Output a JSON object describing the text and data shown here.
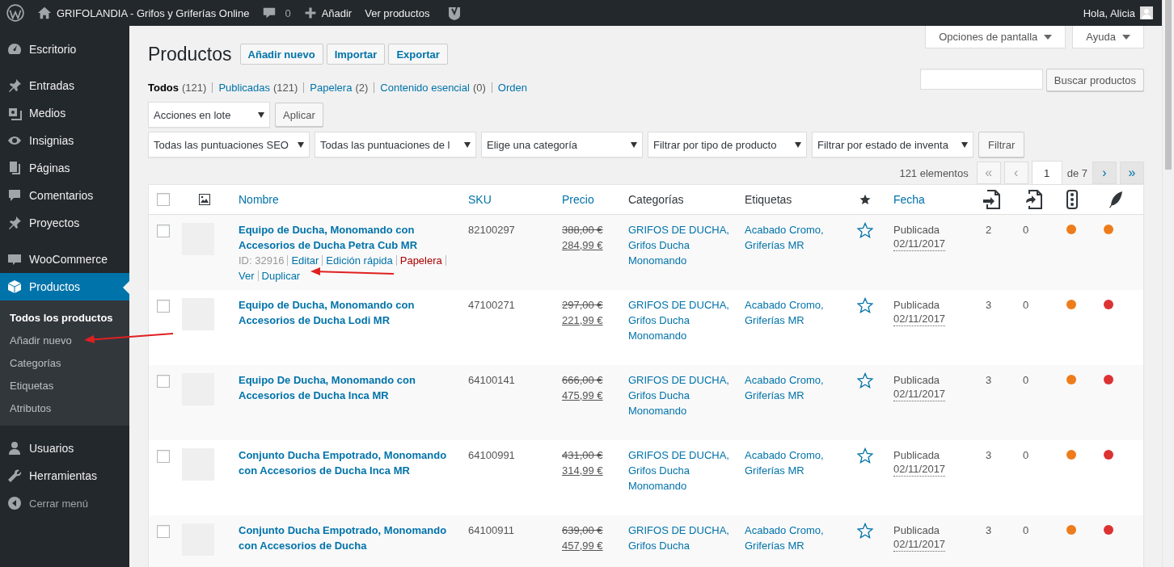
{
  "admin_bar": {
    "site_name": "GRIFOLANDIA - Grifos y Griferías Online",
    "comments_count": "0",
    "new_label": "Añadir",
    "view_label": "Ver productos",
    "greeting": "Hola, Alicia"
  },
  "sidebar": {
    "groups": [
      [
        {
          "label": "Escritorio",
          "kind": "menu",
          "selected": false
        }
      ],
      [
        {
          "label": "Entradas",
          "kind": "menu",
          "selected": false
        },
        {
          "label": "Medios",
          "kind": "menu",
          "selected": false
        },
        {
          "label": "Insignias",
          "kind": "menu",
          "selected": false
        },
        {
          "label": "Páginas",
          "kind": "menu",
          "selected": false
        },
        {
          "label": "Comentarios",
          "kind": "menu",
          "selected": false
        },
        {
          "label": "Proyectos",
          "kind": "menu",
          "selected": false
        }
      ],
      [
        {
          "label": "WooCommerce",
          "kind": "menu",
          "selected": false
        },
        {
          "label": "Productos",
          "kind": "menu",
          "selected": true,
          "children": [
            {
              "label": "Todos los productos",
              "selected": true
            },
            {
              "label": "Añadir nuevo",
              "selected": false
            },
            {
              "label": "Categorías",
              "selected": false
            },
            {
              "label": "Etiquetas",
              "selected": false
            },
            {
              "label": "Atributos",
              "selected": false
            }
          ]
        }
      ],
      [
        {
          "label": "Usuarios",
          "kind": "menu",
          "selected": false
        },
        {
          "label": "Herramientas",
          "kind": "menu",
          "selected": false
        },
        {
          "label": "Cerrar menú",
          "kind": "collapse",
          "selected": false
        }
      ]
    ]
  },
  "screen_tabs": [
    "Opciones de pantalla",
    "Ayuda"
  ],
  "page_title": "Productos",
  "title_actions": [
    "Añadir nuevo",
    "Importar",
    "Exportar"
  ],
  "status_links": [
    {
      "label": "Todos",
      "count": "(121)",
      "selected": true
    },
    {
      "label": "Publicadas",
      "count": "(121)",
      "selected": false
    },
    {
      "label": "Papelera",
      "count": "(2)",
      "selected": false
    },
    {
      "label": "Contenido esencial",
      "count": "(0)",
      "selected": false
    },
    {
      "label": "Orden",
      "selected": false
    }
  ],
  "search": {
    "button": "Buscar productos"
  },
  "bulk_actions": {
    "select": "Acciones en lote",
    "button": "Aplicar"
  },
  "filters": {
    "selects": [
      "Todas las puntuaciones SEO",
      "Todas las puntuaciones de l",
      "Elige una categoría",
      "Filtrar por tipo de producto",
      "Filtrar por estado de inventa"
    ],
    "button": "Filtrar"
  },
  "pagination": {
    "count": "121 elementos",
    "first": {
      "label": "«",
      "disabled": true
    },
    "prev": {
      "label": "‹",
      "disabled": true
    },
    "current": "1",
    "total": "de 7",
    "next": {
      "label": "›",
      "disabled": false
    },
    "last": {
      "label": "»",
      "disabled": false
    }
  },
  "table": {
    "select_all_checked": false,
    "columns": [
      {
        "label": "Nombre",
        "sortable": true
      },
      {
        "label": "SKU",
        "sortable": true
      },
      {
        "label": "Precio",
        "sortable": true
      },
      {
        "label": "Categorías",
        "sortable": false
      },
      {
        "label": "Etiquetas",
        "sortable": false
      },
      {
        "label": "Fecha",
        "sortable": true
      }
    ],
    "rows": [
      {
        "checked": false,
        "name": "Equipo de Ducha, Monomando con Accesorios de Ducha Petra Cub MR",
        "actions": [
          {
            "label": "ID: 32916",
            "kind": "id"
          },
          {
            "label": "Editar",
            "kind": "link"
          },
          {
            "label": "Edición rápida",
            "kind": "link"
          },
          {
            "label": "Papelera",
            "kind": "delete"
          },
          {
            "label": "Ver",
            "kind": "link"
          },
          {
            "label": "Duplicar",
            "kind": "link"
          }
        ],
        "sku": "82100297",
        "regular_price": "388,00 €",
        "sale_price": "284,99 €",
        "categories": "GRIFOS DE DUCHA, Grifos Ducha Monomando",
        "tags": "Acabado Cromo, Griferías MR",
        "featured": false,
        "status": "Publicada",
        "date": "02/11/2017",
        "links_in": "2",
        "links_out": "0",
        "status_dots": [
          {
            "color": "#ee7c1b"
          },
          {
            "color": "#ee7c1b"
          }
        ]
      },
      {
        "checked": false,
        "name": "Equipo de Ducha, Monomando con Accesorios de Ducha Lodi MR",
        "sku": "47100271",
        "regular_price": "297,00 €",
        "sale_price": "221,99 €",
        "categories": "GRIFOS DE DUCHA, Grifos Ducha Monomando",
        "tags": "Acabado Cromo, Griferías MR",
        "featured": false,
        "status": "Publicada",
        "date": "02/11/2017",
        "links_in": "3",
        "links_out": "0",
        "status_dots": [
          {
            "color": "#ee7c1b"
          },
          {
            "color": "#dc3232"
          }
        ]
      },
      {
        "checked": false,
        "name": "Equipo De Ducha, Monomando con Accesorios de Ducha Inca MR",
        "sku": "64100141",
        "regular_price": "666,00 €",
        "sale_price": "475,99 €",
        "categories": "GRIFOS DE DUCHA, Grifos Ducha Monomando",
        "tags": "Acabado Cromo, Griferías MR",
        "featured": false,
        "status": "Publicada",
        "date": "02/11/2017",
        "links_in": "3",
        "links_out": "0",
        "status_dots": [
          {
            "color": "#ee7c1b"
          },
          {
            "color": "#dc3232"
          }
        ]
      },
      {
        "checked": false,
        "name": "Conjunto Ducha Empotrado, Monomando con Accesorios de Ducha Inca MR",
        "sku": "64100991",
        "regular_price": "431,00 €",
        "sale_price": "314,99 €",
        "categories": "GRIFOS DE DUCHA, Grifos Ducha Monomando",
        "tags": "Acabado Cromo, Griferías MR",
        "featured": false,
        "status": "Publicada",
        "date": "02/11/2017",
        "links_in": "3",
        "links_out": "0",
        "status_dots": [
          {
            "color": "#ee7c1b"
          },
          {
            "color": "#dc3232"
          }
        ]
      },
      {
        "checked": false,
        "name": "Conjunto Ducha Empotrado, Monomando con Accesorios de Ducha",
        "sku": "64100911",
        "regular_price": "639,00 €",
        "sale_price": "457,99 €",
        "categories": "GRIFOS DE DUCHA, Grifos Ducha",
        "tags": "Acabado Cromo, Griferías MR",
        "featured": false,
        "status": "Publicada",
        "date": "02/11/2017",
        "links_in": "3",
        "links_out": "0",
        "status_dots": [
          {
            "color": "#ee7c1b"
          },
          {
            "color": "#dc3232"
          }
        ]
      }
    ]
  }
}
